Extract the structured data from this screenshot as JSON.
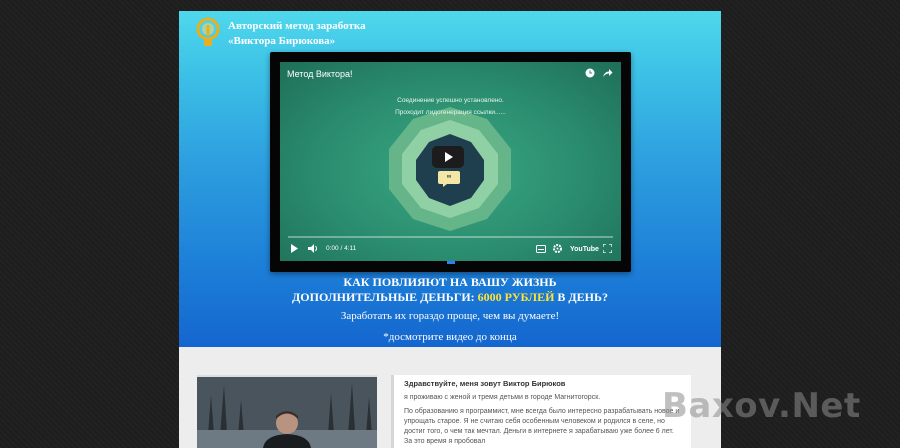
{
  "logo": {
    "line1": "Авторский метод заработка",
    "line2": "«Виктора Бирюкова»"
  },
  "video": {
    "title": "Метод Виктора!",
    "message_line1": "Соединение успешно установлено.",
    "message_line2": "Проходит лидогенерация ссылки......",
    "time": "0:00 / 4:11",
    "youtube_label": "YouTube",
    "icons": [
      "clock-icon",
      "share-icon",
      "play-icon",
      "volume-icon",
      "subtitles-icon",
      "settings-icon",
      "fullscreen-icon",
      "quote-icon"
    ]
  },
  "headline": {
    "line1": "КАК ПОВЛИЯЮТ НА ВАШУ ЖИЗНЬ",
    "line2_prefix": "ДОПОЛНИТЕЛЬНЫЕ ДЕНЬГИ:",
    "line2_highlight": "6000 РУБЛЕЙ",
    "line2_suffix": "В ДЕНЬ?"
  },
  "subtitle1": "Заработать их гораздо проще, чем вы думаете!",
  "subtitle2": "*досмотрите видео до конца",
  "intro": {
    "title": "Здравствуйте, меня зовут Виктор Бирюков",
    "p1": "я проживаю с женой и тремя детьми в городе Магнитогорск.",
    "p2": "По образованию я программист, мне всегда было интересно разрабатывать новое и упрощать старое. Я не считаю себя особенным человеком и родился в селе, но достиг того, о чем так мечтал. Деньги в интернете я зарабатываю уже более 6 лет. За это время я пробовал"
  },
  "watermark": "Baxov.Net",
  "colors": {
    "accent_yellow": "#ffe23a",
    "logo_gold": "#e8b020",
    "video_green": "#2a8c6e"
  }
}
